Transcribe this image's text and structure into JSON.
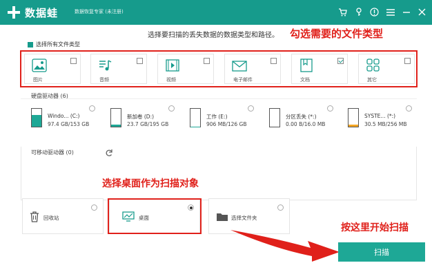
{
  "app": {
    "name": "数据蛙",
    "subtitle": "数据恢复专家 (未注册)"
  },
  "titlebar_icons": [
    "cart-icon",
    "key-icon",
    "help-icon",
    "menu-icon",
    "minimize-icon",
    "close-icon"
  ],
  "instruction": "选择要扫描的丢失数据的数据类型和路径。",
  "annotations": {
    "file_types": "勾选需要的文件类型",
    "desktop": "选择桌面作为扫描对象",
    "scan": "按这里开始扫描"
  },
  "select_all": "选择所有文件类型",
  "file_types": [
    {
      "label": "图片",
      "icon": "image-icon",
      "checked": false
    },
    {
      "label": "音频",
      "icon": "audio-icon",
      "checked": false
    },
    {
      "label": "视频",
      "icon": "video-icon",
      "checked": false
    },
    {
      "label": "电子邮件",
      "icon": "email-icon",
      "checked": false
    },
    {
      "label": "文档",
      "icon": "document-icon",
      "checked": true
    },
    {
      "label": "其它",
      "icon": "other-icon",
      "checked": false
    }
  ],
  "drives_header": "硬盘驱动器 (6)",
  "drives": [
    {
      "name": "Windo... (C:)",
      "size": "97.4 GB/153 GB",
      "fill_color": "#1ea896",
      "fill_level": 0.64
    },
    {
      "name": "新加卷 (D:)",
      "size": "23.7 GB/195 GB",
      "fill_color": "#1ea896",
      "fill_level": 0.12
    },
    {
      "name": "工作 (E:)",
      "size": "906 MB/126 GB",
      "fill_color": "#1ea896",
      "fill_level": 0.01
    },
    {
      "name": "分区丢失 (*:)",
      "size": "0.00  B/16.0 MB",
      "fill_color": "#f5a623",
      "fill_level": 0.0
    },
    {
      "name": "SYSTE... (*:)",
      "size": "30.5 MB/256 MB",
      "fill_color": "#f5a623",
      "fill_level": 0.12
    }
  ],
  "removable_header": "可移动驱动器 (0)",
  "locations": [
    {
      "label": "回收站",
      "icon": "recycle-bin-icon",
      "selected": false
    },
    {
      "label": "桌面",
      "icon": "desktop-icon",
      "selected": true
    },
    {
      "label": "选择文件夹",
      "icon": "folder-icon",
      "selected": false
    }
  ],
  "scan_button": "扫描",
  "colors": {
    "brand": "#169b8c",
    "button": "#1ea896",
    "annotation": "#e0201a"
  }
}
